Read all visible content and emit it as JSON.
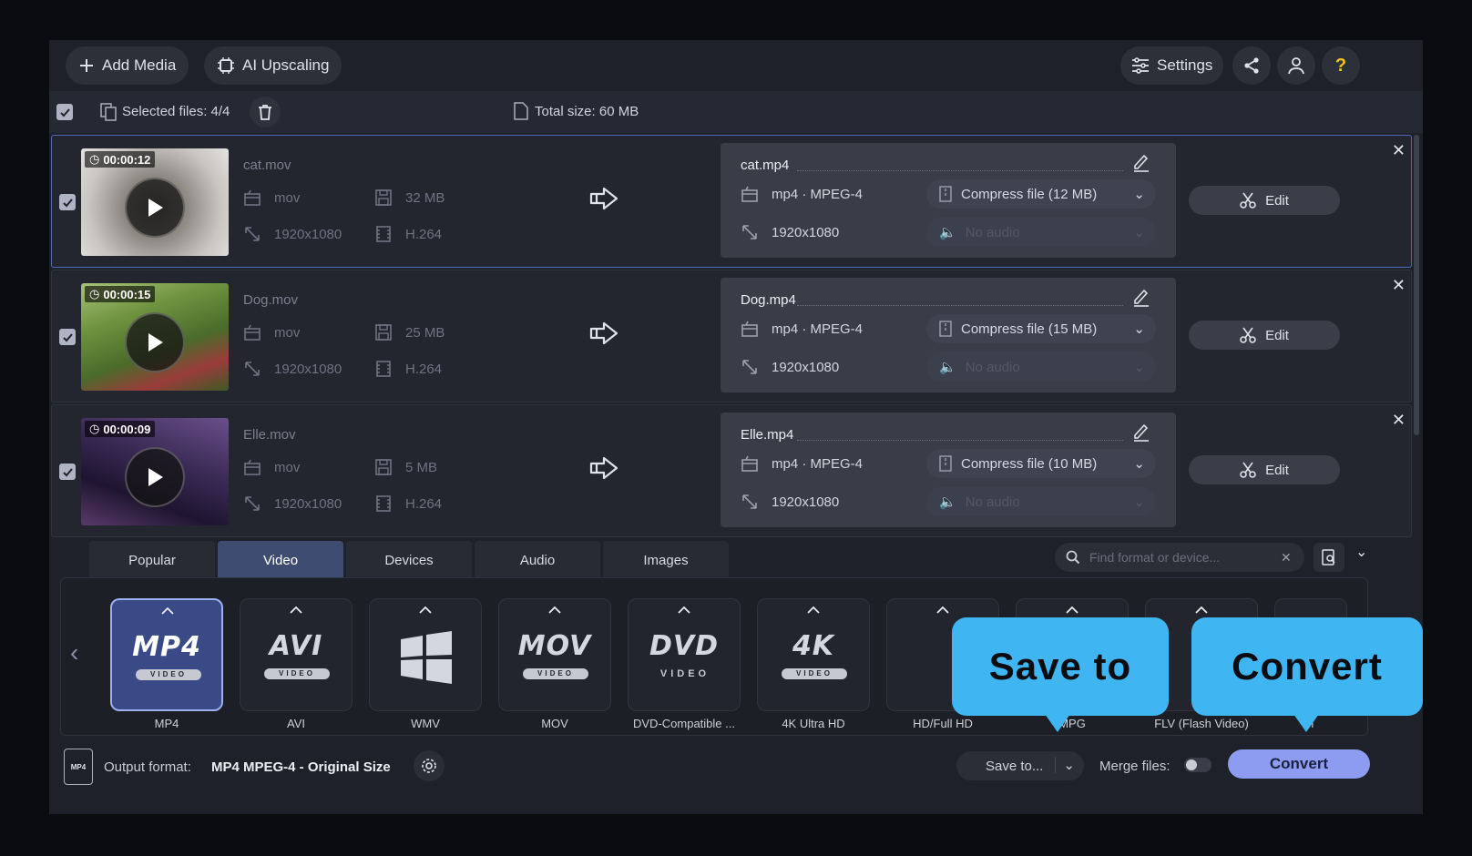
{
  "toolbar": {
    "add_media": "Add Media",
    "ai_upscaling": "AI Upscaling",
    "settings": "Settings"
  },
  "selection": {
    "selected_label": "Selected files: 4/4",
    "total_size": "Total size: 60 MB"
  },
  "files": [
    {
      "duration": "00:00:12",
      "source_name": "cat.mov",
      "container": "mov",
      "size": "32 MB",
      "resolution": "1920x1080",
      "codec": "H.264",
      "output_name": "cat.mp4",
      "output_format": "mp4 · MPEG-4",
      "compress": "Compress file (12 MB)",
      "output_resolution": "1920x1080",
      "audio": "No audio",
      "edit": "Edit"
    },
    {
      "duration": "00:00:15",
      "source_name": "Dog.mov",
      "container": "mov",
      "size": "25 MB",
      "resolution": "1920x1080",
      "codec": "H.264",
      "output_name": "Dog.mp4",
      "output_format": "mp4 · MPEG-4",
      "compress": "Compress file (15 MB)",
      "output_resolution": "1920x1080",
      "audio": "No audio",
      "edit": "Edit"
    },
    {
      "duration": "00:00:09",
      "source_name": "Elle.mov",
      "container": "mov",
      "size": "5 MB",
      "resolution": "1920x1080",
      "codec": "H.264",
      "output_name": "Elle.mp4",
      "output_format": "mp4 · MPEG-4",
      "compress": "Compress file (10 MB)",
      "output_resolution": "1920x1080",
      "audio": "No audio",
      "edit": "Edit"
    }
  ],
  "tabs": [
    "Popular",
    "Video",
    "Devices",
    "Audio",
    "Images"
  ],
  "selected_tab": "Video",
  "search": {
    "placeholder": "Find format or device..."
  },
  "formats": [
    {
      "logo": "MP4",
      "sub": "VIDEO",
      "label": "MP4",
      "selected": true
    },
    {
      "logo": "AVI",
      "sub": "VIDEO",
      "label": "AVI"
    },
    {
      "logo": "",
      "sub": "",
      "label": "WMV"
    },
    {
      "logo": "MOV",
      "sub": "VIDEO",
      "label": "MOV"
    },
    {
      "logo": "DVD",
      "sub": "VIDEO",
      "label": "DVD-Compatible ..."
    },
    {
      "logo": "4K",
      "sub": "VIDEO",
      "label": "4K Ultra HD"
    },
    {
      "logo": "",
      "sub": "",
      "label": "HD/Full HD"
    },
    {
      "logo": "",
      "sub": "",
      "label": "MPG"
    },
    {
      "logo": "",
      "sub": "",
      "label": "FLV (Flash Video)"
    },
    {
      "logo": "",
      "sub": "",
      "label": "M"
    }
  ],
  "bottom": {
    "output_label": "Output format:",
    "output_value": "MP4 MPEG-4 - Original Size",
    "save_to": "Save to...",
    "merge_files": "Merge files:",
    "convert": "Convert"
  },
  "callouts": {
    "save_to": "Save to",
    "convert": "Convert"
  },
  "colors": {
    "accent": "#8d9cf0",
    "callout": "#3fb6f2",
    "selected_tab": "#3f4c72"
  }
}
